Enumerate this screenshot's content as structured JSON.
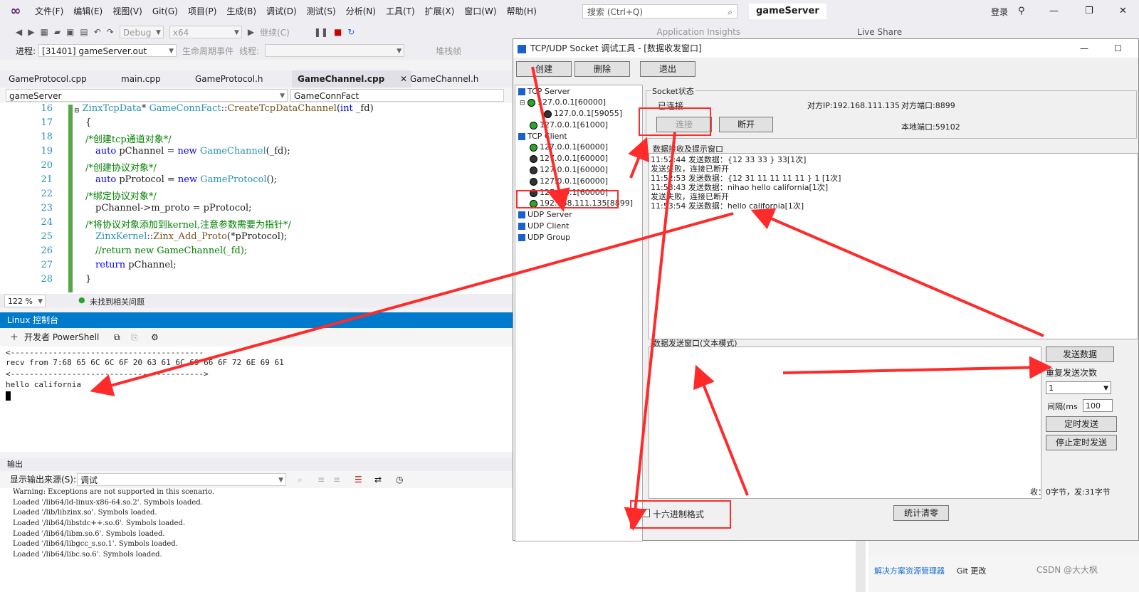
{
  "menubar": {
    "items": [
      "文件(F)",
      "编辑(E)",
      "视图(V)",
      "Git(G)",
      "项目(P)",
      "生成(B)",
      "调试(D)",
      "测试(S)",
      "分析(N)",
      "工具(T)",
      "扩展(X)",
      "窗口(W)",
      "帮助(H)"
    ],
    "search_placeholder": "搜索 (Ctrl+Q)",
    "solution_name": "gameServer",
    "login": "登录"
  },
  "toolbar": {
    "config": "Debug",
    "platform": "x64",
    "continue": "继续(C)",
    "app_insights": "Application Insights",
    "live_share": "Live Share"
  },
  "debugbar": {
    "process_label": "进程:",
    "process_value": "[31401] gameServer.out",
    "lifecycle": "生命周期事件",
    "thread_label": "线程:",
    "stack_frame": "堆栈帧"
  },
  "editor": {
    "tabs": [
      "GameProtocol.cpp",
      "main.cpp",
      "GameProtocol.h",
      "GameChannel.cpp",
      "GameChannel.h"
    ],
    "active_tab": "GameChannel.cpp",
    "nav_scope": "gameServer",
    "nav_member": "GameConnFact",
    "line_numbers": [
      "16",
      "17",
      "18",
      "19",
      "20",
      "21",
      "22",
      "23",
      "24",
      "25",
      "26",
      "27",
      "28"
    ],
    "zoom": "122 %",
    "issues": "未找到相关问题"
  },
  "code": {
    "l16": [
      "ZinxTcpData",
      "* ",
      "GameConnFact",
      "::",
      "CreateTcpDataChannel",
      "(",
      "int",
      " _fd)"
    ],
    "l17": "{",
    "l18": "/*创建tcp通道对象*/",
    "l19": [
      "auto",
      " pChannel = ",
      "new",
      " ",
      "GameChannel",
      "(_fd);"
    ],
    "l20": "/*创建协议对象*/",
    "l21": [
      "auto",
      " pProtocol = ",
      "new",
      " ",
      "GameProtocol",
      "();"
    ],
    "l22": "/*绑定协议对象*/",
    "l23": "pChannel->m_proto = pProtocol;",
    "l24": "/*将协议对象添加到kernel,注意参数需要为指针*/",
    "l25": [
      "ZinxKernel",
      "::",
      "Zinx_Add_Proto",
      "(*pProtocol);"
    ],
    "l26": "//return new GameChannel(_fd);",
    "l27": [
      "return",
      " pChannel;"
    ],
    "l28": "}"
  },
  "console": {
    "title": "Linux 控制台",
    "shell": "开发者 PowerShell",
    "lines": [
      "<-----------------------------------------",
      "recv from 7:68 65 6C 6C 6F 20 63 61 6C 69 66 6F 72 6E 69 61",
      "<----------------------------------------->",
      "hello california"
    ]
  },
  "output": {
    "title": "输出",
    "source_label": "显示输出来源(S):",
    "source_value": "调试",
    "lines": [
      "Warning: Exceptions are not supported in this scenario.",
      "Loaded '/lib64/ld-linux-x86-64.so.2'. Symbols loaded.",
      "Loaded '/lib/libzinx.so'. Symbols loaded.",
      "Loaded '/lib64/libstdc++.so.6'. Symbols loaded.",
      "Loaded '/lib64/libm.so.6'. Symbols loaded.",
      "Loaded '/lib64/libgcc_s.so.1'. Symbols loaded.",
      "Loaded '/lib64/libc.so.6'. Symbols loaded."
    ]
  },
  "bottom_right": {
    "solution_explorer": "解决方案资源管理器",
    "git_changes": "Git 更改",
    "watermark": "CSDN @大大枫"
  },
  "socket_tool": {
    "title": "TCP/UDP Socket 调试工具 - [数据收发窗口]",
    "buttons": {
      "create": "创建",
      "delete": "删除",
      "exit": "退出"
    },
    "tree": {
      "tcp_server": "TCP Server",
      "server_node": "127.0.0.1[60000]",
      "server_child": "127.0.0.1[59055]",
      "server_node2": "127.0.0.1[61000]",
      "tcp_client": "TCP Client",
      "clients": [
        "127.0.0.1[60000]",
        "127.0.0.1[60000]",
        "127.0.0.1[60000]",
        "127.0.0.1[60000]",
        "127.0.0.1[60000]",
        "192.168.111.135[8899]"
      ],
      "udp_server": "UDP Server",
      "udp_client": "UDP Client",
      "udp_group": "UDP Group"
    },
    "status": {
      "group_label": "Socket状态",
      "state": "已连接",
      "remote_ip": "对方IP:192.168.111.135",
      "remote_port": "对方端口:8899",
      "local_port": "本地端口:59102",
      "connect": "连接",
      "disconnect": "断开"
    },
    "recv": {
      "group_label": "数据接收及提示窗口",
      "lines": [
        "11:52:44 发送数据：{12 33 33 } 33[1次]",
        "发送失败，连接已断开",
        "11:52:53 发送数据：{12 31 11 11 11 11 } 1   [1次]",
        "11:53:43 发送数据：nihao hello california[1次]",
        "发送失败，连接已断开",
        "11:53:54 发送数据：hello california[1次]"
      ]
    },
    "send": {
      "group_label": "数据发送窗口(文本模式)",
      "send_button": "发送数据",
      "repeat_label": "重复发送次数",
      "repeat_value": "1",
      "interval_label": "间隔(ms",
      "interval_value": "100",
      "timed_send": "定时发送",
      "stop_timed": "停止定时发送",
      "stats": "收：0字节，发:31字节",
      "hex_mode": "十六进制格式",
      "clear_stats": "统计清零"
    }
  },
  "colors": {
    "annotation": "#ff2a2a",
    "vs_accent": "#007acc",
    "tree_icon": "#1c5fce"
  }
}
